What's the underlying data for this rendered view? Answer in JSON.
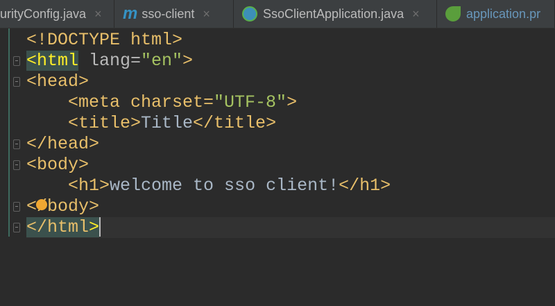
{
  "tabs": [
    {
      "label": "urityConfig.java",
      "icon": "java-class-icon"
    },
    {
      "label": "sso-client",
      "icon": "maven-m-icon"
    },
    {
      "label": "SsoClientApplication.java",
      "icon": "spring-boot-class-icon"
    },
    {
      "label": "application.pr",
      "icon": "spring-properties-icon"
    }
  ],
  "close_glyph": "×",
  "code": {
    "l1": "<!DOCTYPE html>",
    "l2a": "<html",
    "l2b": " lang=",
    "l2c": "\"en\"",
    "l2d": ">",
    "l3": "<head>",
    "l4a": "    <meta charset=",
    "l4b": "\"UTF-8\"",
    "l4c": ">",
    "l5a": "    <title>",
    "l5b": "Title",
    "l5c": "</title>",
    "l6": "</head>",
    "l7": "<body>",
    "l8a": "    <h1>",
    "l8b": "welcome to sso client!",
    "l8c": "</h1>",
    "l9": "</body>",
    "l10a": "</html",
    "l10b": ">"
  }
}
